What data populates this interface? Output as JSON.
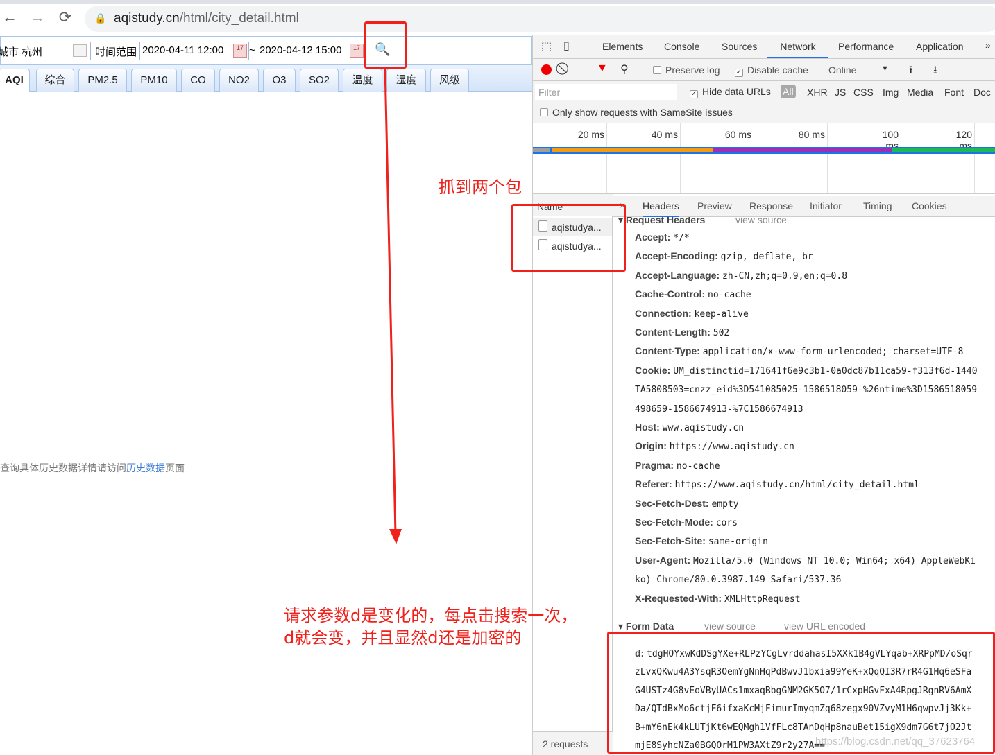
{
  "browser": {
    "url_domain": "aqistudy.cn",
    "url_path": "/html/city_detail.html",
    "back_icon": "arrow-left-icon",
    "forward_icon": "arrow-right-icon",
    "reload_icon": "reload-icon"
  },
  "page": {
    "city_label": "城市",
    "city_value": "杭州",
    "time_label": "时间范围",
    "start_time": "2020-04-11 12:00",
    "tilde": "~",
    "end_time": "2020-04-12 15:00",
    "tabs": [
      "AQI",
      "综合",
      "PM2.5",
      "PM10",
      "CO",
      "NO2",
      "O3",
      "SO2",
      "温度",
      "湿度",
      "风级"
    ],
    "active_tab": "AQI",
    "hint_prefix": "查询具体历史数据详情请访问",
    "hint_link": "历史数据",
    "hint_suffix": "页面"
  },
  "devtools": {
    "tabs": [
      "Elements",
      "Console",
      "Sources",
      "Network",
      "Performance",
      "Application"
    ],
    "active_tab": "Network",
    "more": "»",
    "preserve_log": "Preserve log",
    "preserve_log_checked": false,
    "disable_cache": "Disable cache",
    "disable_cache_checked": true,
    "throttle": "Online",
    "filter_placeholder": "Filter",
    "hide_data_urls": "Hide data URLs",
    "hide_data_urls_checked": true,
    "type_filters": [
      "All",
      "XHR",
      "JS",
      "CSS",
      "Img",
      "Media",
      "Font",
      "Doc"
    ],
    "samesite": "Only show requests with SameSite issues",
    "timeline_ticks": [
      "20 ms",
      "40 ms",
      "60 ms",
      "80 ms",
      "100 ms",
      "120 ms"
    ],
    "name_header": "Name",
    "requests": [
      "aqistudya...",
      "aqistudya..."
    ],
    "status": "2 requests",
    "detail_tabs": [
      "Headers",
      "Preview",
      "Response",
      "Initiator",
      "Timing",
      "Cookies"
    ],
    "active_detail_tab": "Headers",
    "close": "×",
    "request_headers_title": "Request Headers",
    "view_source": "view source",
    "headers": [
      {
        "k": "Accept:",
        "v": "*/*"
      },
      {
        "k": "Accept-Encoding:",
        "v": "gzip, deflate, br"
      },
      {
        "k": "Accept-Language:",
        "v": "zh-CN,zh;q=0.9,en;q=0.8"
      },
      {
        "k": "Cache-Control:",
        "v": "no-cache"
      },
      {
        "k": "Connection:",
        "v": "keep-alive"
      },
      {
        "k": "Content-Length:",
        "v": "502"
      },
      {
        "k": "Content-Type:",
        "v": "application/x-www-form-urlencoded; charset=UTF-8"
      },
      {
        "k": "Cookie:",
        "v": "UM_distinctid=171641f6e9c3b1-0a0dc87b11ca59-f313f6d-1440"
      },
      {
        "k": "",
        "v": "TA5808503=cnzz_eid%3D541085025-1586518059-%26ntime%3D1586518059"
      },
      {
        "k": "",
        "v": "498659-1586674913-%7C1586674913"
      },
      {
        "k": "Host:",
        "v": "www.aqistudy.cn"
      },
      {
        "k": "Origin:",
        "v": "https://www.aqistudy.cn"
      },
      {
        "k": "Pragma:",
        "v": "no-cache"
      },
      {
        "k": "Referer:",
        "v": "https://www.aqistudy.cn/html/city_detail.html"
      },
      {
        "k": "Sec-Fetch-Dest:",
        "v": "empty"
      },
      {
        "k": "Sec-Fetch-Mode:",
        "v": "cors"
      },
      {
        "k": "Sec-Fetch-Site:",
        "v": "same-origin"
      },
      {
        "k": "User-Agent:",
        "v": "Mozilla/5.0 (Windows NT 10.0; Win64; x64) AppleWebKi"
      },
      {
        "k": "",
        "v": "ko) Chrome/80.0.3987.149 Safari/537.36"
      },
      {
        "k": "X-Requested-With:",
        "v": "XMLHttpRequest"
      }
    ],
    "form_data_title": "Form Data",
    "view_url_encoded": "view URL encoded",
    "form_key": "d:",
    "form_lines": [
      "tdgHOYxwKdDSgYXe+RLPzYCgLvrddahasI5XXk1B4gVLYqab+XRPpMD/oSqr",
      "zLvxQKwu4A3YsqR3OemYgNnHqPdBwvJ1bxia99YeK+xQqQI3R7rR4G1Hq6eSFa",
      "G4USTz4G8vEoVByUACs1mxaqBbgGNM2GK5O7/1rCxpHGvFxA4RpgJRgnRV6AmX",
      "Da/QTdBxMo6ctjF6ifxaKcMjFimurImyqmZq68zegx90VZvyM1H6qwpvJj3Kk+",
      "B+mY6nEk4kLUTjKt6wEQMgh1VfFLc8TAnDqHp8nauBet15igX9dm7G6t7jO2Jt",
      "mjE8SyhcNZa0BGQOrM1PW3AXtZ9r2y27A=="
    ],
    "timeline_colors": {
      "stalled": "#9e9e9e",
      "waiting": "#f39c12",
      "download": "#9b30b5",
      "finish": "#1db954",
      "line": "#1a73e8"
    }
  },
  "annotations": {
    "captured": "抓到两个包",
    "note_line1": "请求参数d是变化的，每点击搜索一次，",
    "note_line2": "d就会变，并且显然d还是加密的",
    "color": "#f0201a",
    "watermark": "https://blog.csdn.net/qq_37623764"
  }
}
